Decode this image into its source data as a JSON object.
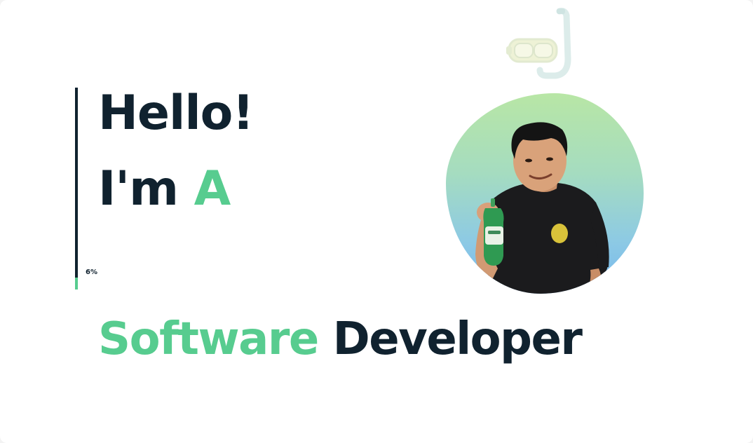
{
  "hero": {
    "greeting": "Hello!",
    "intro_prefix": "I'm",
    "intro_accent": "A",
    "role_accent": "Software",
    "role_rest": "Developer"
  },
  "scroll_progress": {
    "value": 0.06,
    "label": "6%"
  },
  "colors": {
    "accent": "#57cc8f",
    "text": "#10222f",
    "background": "#ffffff"
  },
  "icons": {
    "decoration": "snorkel-mask-icon"
  }
}
